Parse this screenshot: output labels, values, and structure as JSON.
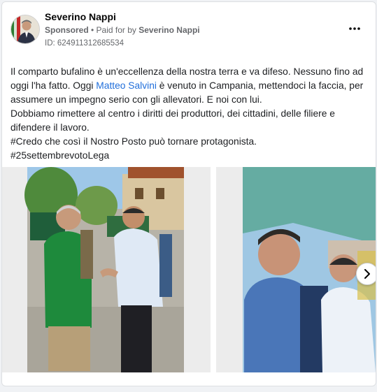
{
  "post": {
    "author": "Severino Nappi",
    "sponsored_label": "Sponsored",
    "paid_for_prefix": " • Paid for by ",
    "paid_for_name": "Severino Nappi",
    "ad_id": "ID: 624911312685534",
    "more_icon": "more-horizontal-icon",
    "text": {
      "line1": "Il comparto bufalino è un'eccellenza della nostra terra e va difeso. Nessuno fino ad oggi l'ha fatto. Oggi ",
      "mention": "Matteo Salvini",
      "line1_after": " è venuto in Campania, mettendoci la faccia, per assumere un impegno serio con gli allevatori. E noi con lui.",
      "line2": "Dobbiamo rimettere al centro i diritti dei produttori, dei cittadini, delle filiere e difendere il lavoro.",
      "line3": "#Credo che così il Nostro Posto può tornare protagonista.",
      "line4": "#25settembrevotoLega"
    }
  },
  "carousel": {
    "next_icon": "chevron-right-icon"
  },
  "colors": {
    "mention": "#216fdb",
    "secondary_text": "#65676b",
    "card_bg": "#ffffff",
    "page_bg": "#f0f2f5"
  }
}
